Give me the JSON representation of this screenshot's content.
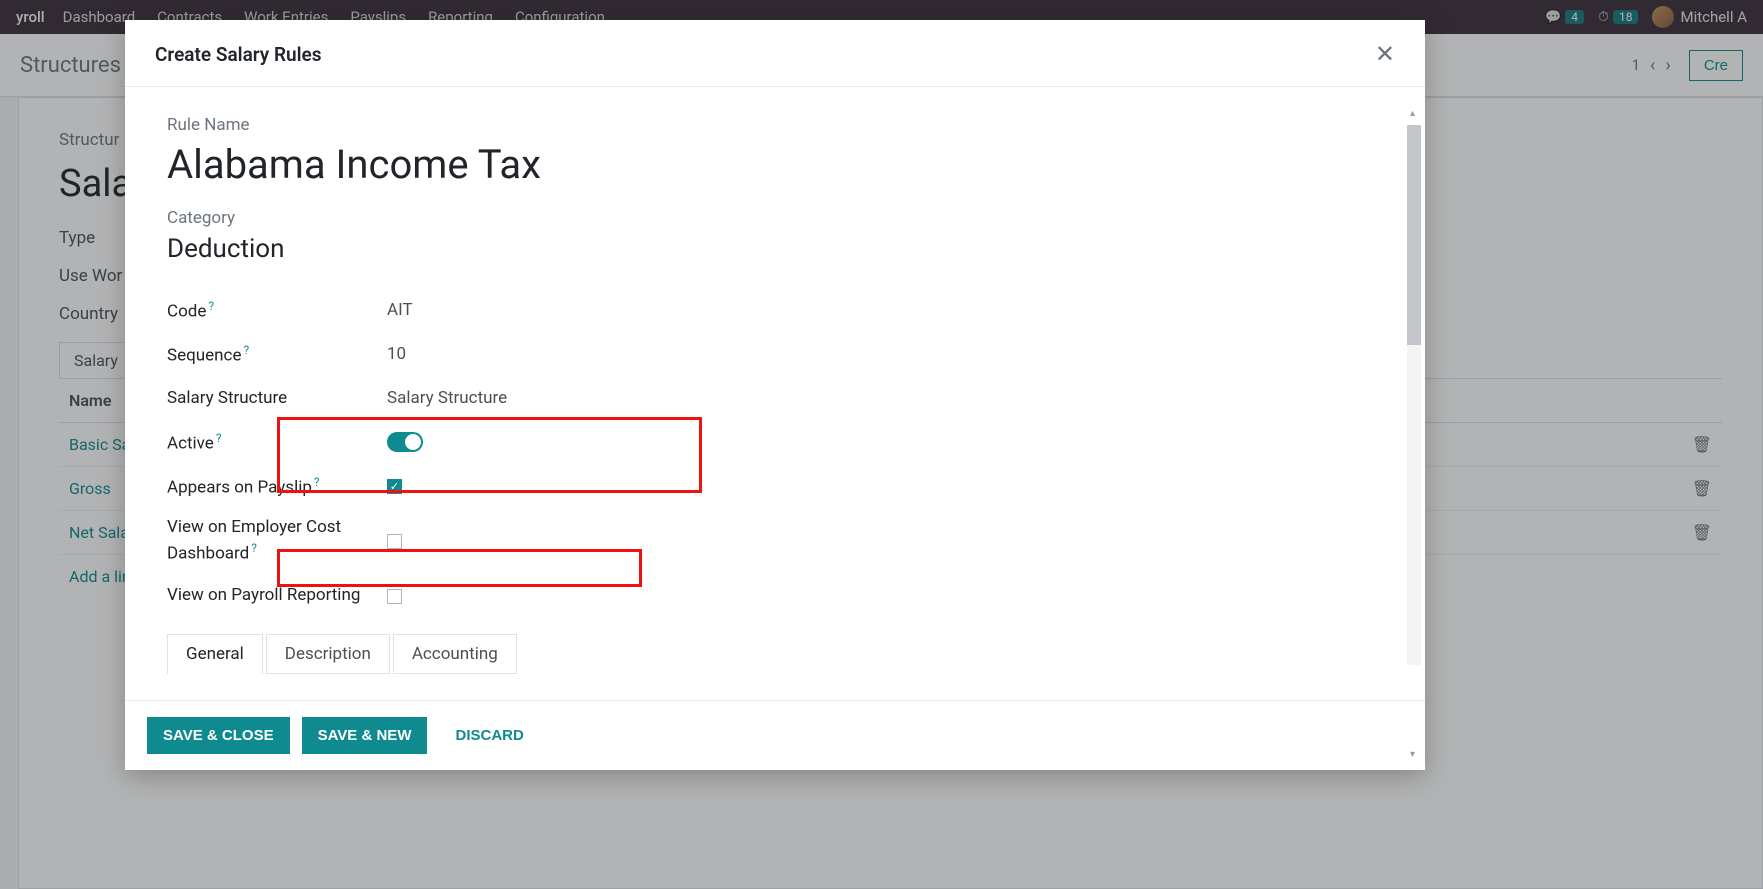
{
  "topbar": {
    "brand": "yroll",
    "menu": [
      "Dashboard",
      "Contracts",
      "Work Entries",
      "Payslips",
      "Reporting",
      "Configuration"
    ],
    "chat_count": "4",
    "activity_count": "18",
    "user_name": "Mitchell A"
  },
  "secbar": {
    "breadcrumb": "Structures",
    "pager": "1",
    "create_label": "Cre"
  },
  "bg": {
    "structure_name_label": "Structur",
    "structure_name": "Sala",
    "rows": {
      "type": "Type",
      "use_worked": "Use Wor",
      "country": "Country"
    },
    "tab": "Salary",
    "col_name": "Name",
    "names": [
      "Basic Sa",
      "Gross",
      "Net Sala"
    ],
    "add_line": "Add a lir"
  },
  "modal": {
    "title": "Create Salary Rules",
    "labels": {
      "rule_name": "Rule Name",
      "category": "Category",
      "code": "Code",
      "sequence": "Sequence",
      "salary_structure": "Salary Structure",
      "active": "Active",
      "appears_on_payslip": "Appears on Payslip",
      "view_employer_cost": "View on Employer Cost Dashboard",
      "view_payroll_reporting": "View on Payroll Reporting"
    },
    "values": {
      "rule_name": "Alabama Income Tax",
      "category": "Deduction",
      "code": "AIT",
      "sequence": "10",
      "salary_structure": "Salary Structure",
      "active": true,
      "appears_on_payslip": true,
      "view_employer_cost": false,
      "view_payroll_reporting": false
    },
    "tabs": [
      "General",
      "Description",
      "Accounting"
    ],
    "footer": {
      "save_close": "SAVE & CLOSE",
      "save_new": "SAVE & NEW",
      "discard": "DISCARD"
    }
  }
}
